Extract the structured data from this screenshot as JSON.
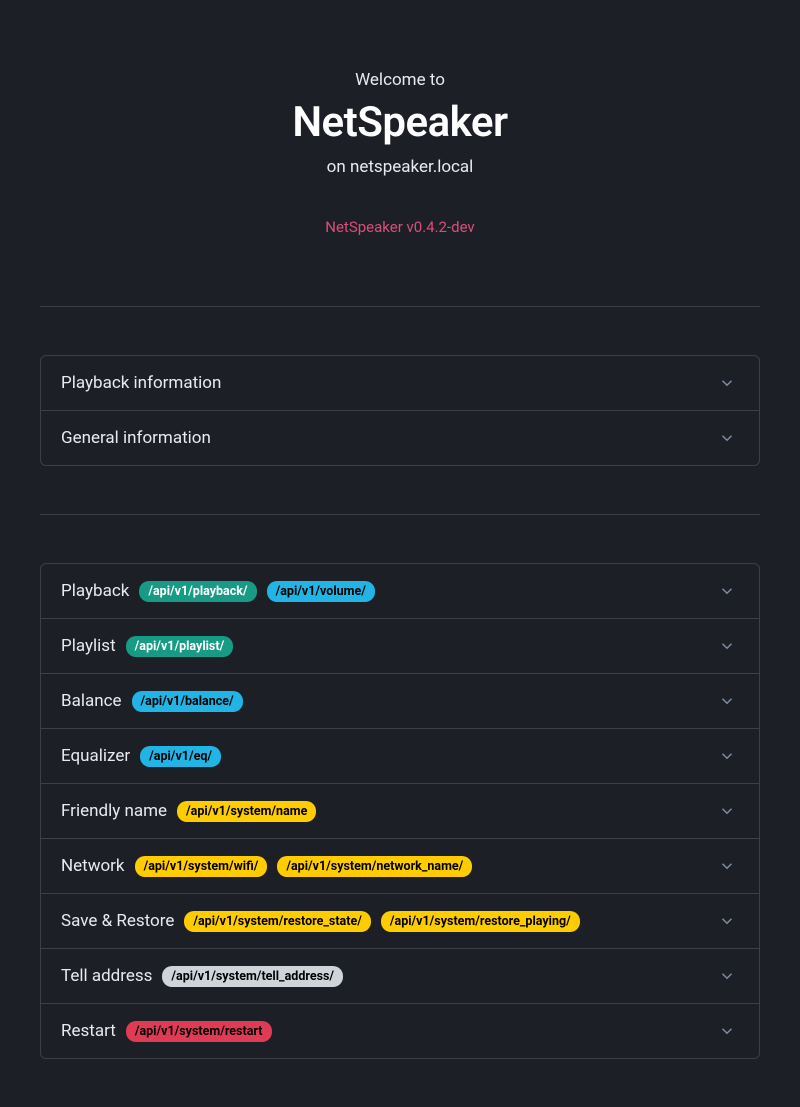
{
  "header": {
    "welcome": "Welcome to",
    "brand": "NetSpeaker",
    "host": "on netspeaker.local",
    "version": "NetSpeaker v0.4.2-dev"
  },
  "info_sections": [
    {
      "title": "Playback information"
    },
    {
      "title": "General information"
    }
  ],
  "api_sections": [
    {
      "title": "Playback",
      "badges": [
        {
          "text": "/api/v1/playback/",
          "color": "teal"
        },
        {
          "text": "/api/v1/volume/",
          "color": "blue"
        }
      ]
    },
    {
      "title": "Playlist",
      "badges": [
        {
          "text": "/api/v1/playlist/",
          "color": "teal"
        }
      ]
    },
    {
      "title": "Balance",
      "badges": [
        {
          "text": "/api/v1/balance/",
          "color": "blue"
        }
      ]
    },
    {
      "title": "Equalizer",
      "badges": [
        {
          "text": "/api/v1/eq/",
          "color": "blue"
        }
      ]
    },
    {
      "title": "Friendly name",
      "badges": [
        {
          "text": "/api/v1/system/name",
          "color": "yellow"
        }
      ]
    },
    {
      "title": "Network",
      "badges": [
        {
          "text": "/api/v1/system/wifi/",
          "color": "yellow"
        },
        {
          "text": "/api/v1/system/network_name/",
          "color": "yellow"
        }
      ]
    },
    {
      "title": "Save & Restore",
      "badges": [
        {
          "text": "/api/v1/system/restore_state/",
          "color": "yellow"
        },
        {
          "text": "/api/v1/system/restore_playing/",
          "color": "yellow"
        }
      ]
    },
    {
      "title": "Tell address",
      "badges": [
        {
          "text": "/api/v1/system/tell_address/",
          "color": "grey"
        }
      ]
    },
    {
      "title": "Restart",
      "badges": [
        {
          "text": "/api/v1/system/restart",
          "color": "red"
        }
      ]
    }
  ]
}
